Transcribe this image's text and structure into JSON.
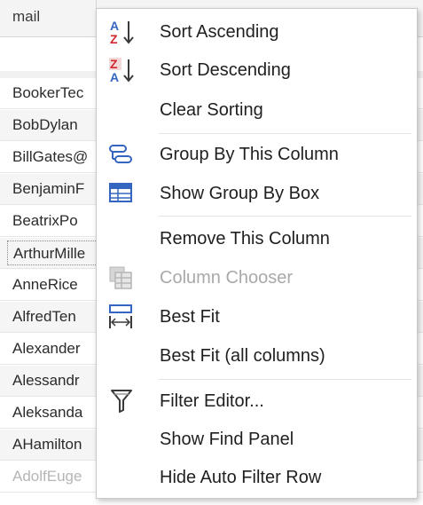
{
  "grid": {
    "column_header": "mail",
    "rows": [
      {
        "text": "BookerTec",
        "alt": false,
        "focused": false,
        "faded": false
      },
      {
        "text": "BobDylan",
        "alt": true,
        "focused": false,
        "faded": false
      },
      {
        "text": "BillGates@",
        "alt": false,
        "focused": false,
        "faded": false
      },
      {
        "text": "BenjaminF",
        "alt": true,
        "focused": false,
        "faded": false
      },
      {
        "text": "BeatrixPo",
        "alt": false,
        "focused": false,
        "faded": false
      },
      {
        "text": "ArthurMille",
        "alt": true,
        "focused": true,
        "faded": false
      },
      {
        "text": "AnneRice",
        "alt": false,
        "focused": false,
        "faded": false
      },
      {
        "text": "AlfredTen",
        "alt": true,
        "focused": false,
        "faded": false
      },
      {
        "text": "Alexander",
        "alt": false,
        "focused": false,
        "faded": false
      },
      {
        "text": "Alessandr",
        "alt": true,
        "focused": false,
        "faded": false
      },
      {
        "text": "Aleksanda",
        "alt": false,
        "focused": false,
        "faded": false
      },
      {
        "text": "AHamilton",
        "alt": true,
        "focused": false,
        "faded": false
      },
      {
        "text": "AdolfEuge",
        "alt": false,
        "focused": false,
        "faded": true
      }
    ]
  },
  "menu": {
    "items": [
      {
        "label": "Sort Ascending",
        "icon": "sort-ascending-icon",
        "enabled": true
      },
      {
        "label": "Sort Descending",
        "icon": "sort-descending-icon",
        "enabled": true
      },
      {
        "label": "Clear Sorting",
        "icon": "",
        "enabled": true
      },
      {
        "label": "Group By This Column",
        "icon": "group-by-column-icon",
        "enabled": true
      },
      {
        "label": "Show Group By Box",
        "icon": "group-by-box-icon",
        "enabled": true
      },
      {
        "label": "Remove This Column",
        "icon": "",
        "enabled": true
      },
      {
        "label": "Column Chooser",
        "icon": "column-chooser-icon",
        "enabled": false
      },
      {
        "label": "Best Fit",
        "icon": "best-fit-icon",
        "enabled": true
      },
      {
        "label": "Best Fit (all columns)",
        "icon": "",
        "enabled": true
      },
      {
        "label": "Filter Editor...",
        "icon": "filter-editor-icon",
        "enabled": true
      },
      {
        "label": "Show Find Panel",
        "icon": "",
        "enabled": true
      },
      {
        "label": "Hide Auto Filter Row",
        "icon": "",
        "enabled": true
      }
    ]
  },
  "colors": {
    "accent_blue": "#3466c1",
    "accent_red": "#d3262d",
    "disabled_gray": "#a9a9a9"
  }
}
